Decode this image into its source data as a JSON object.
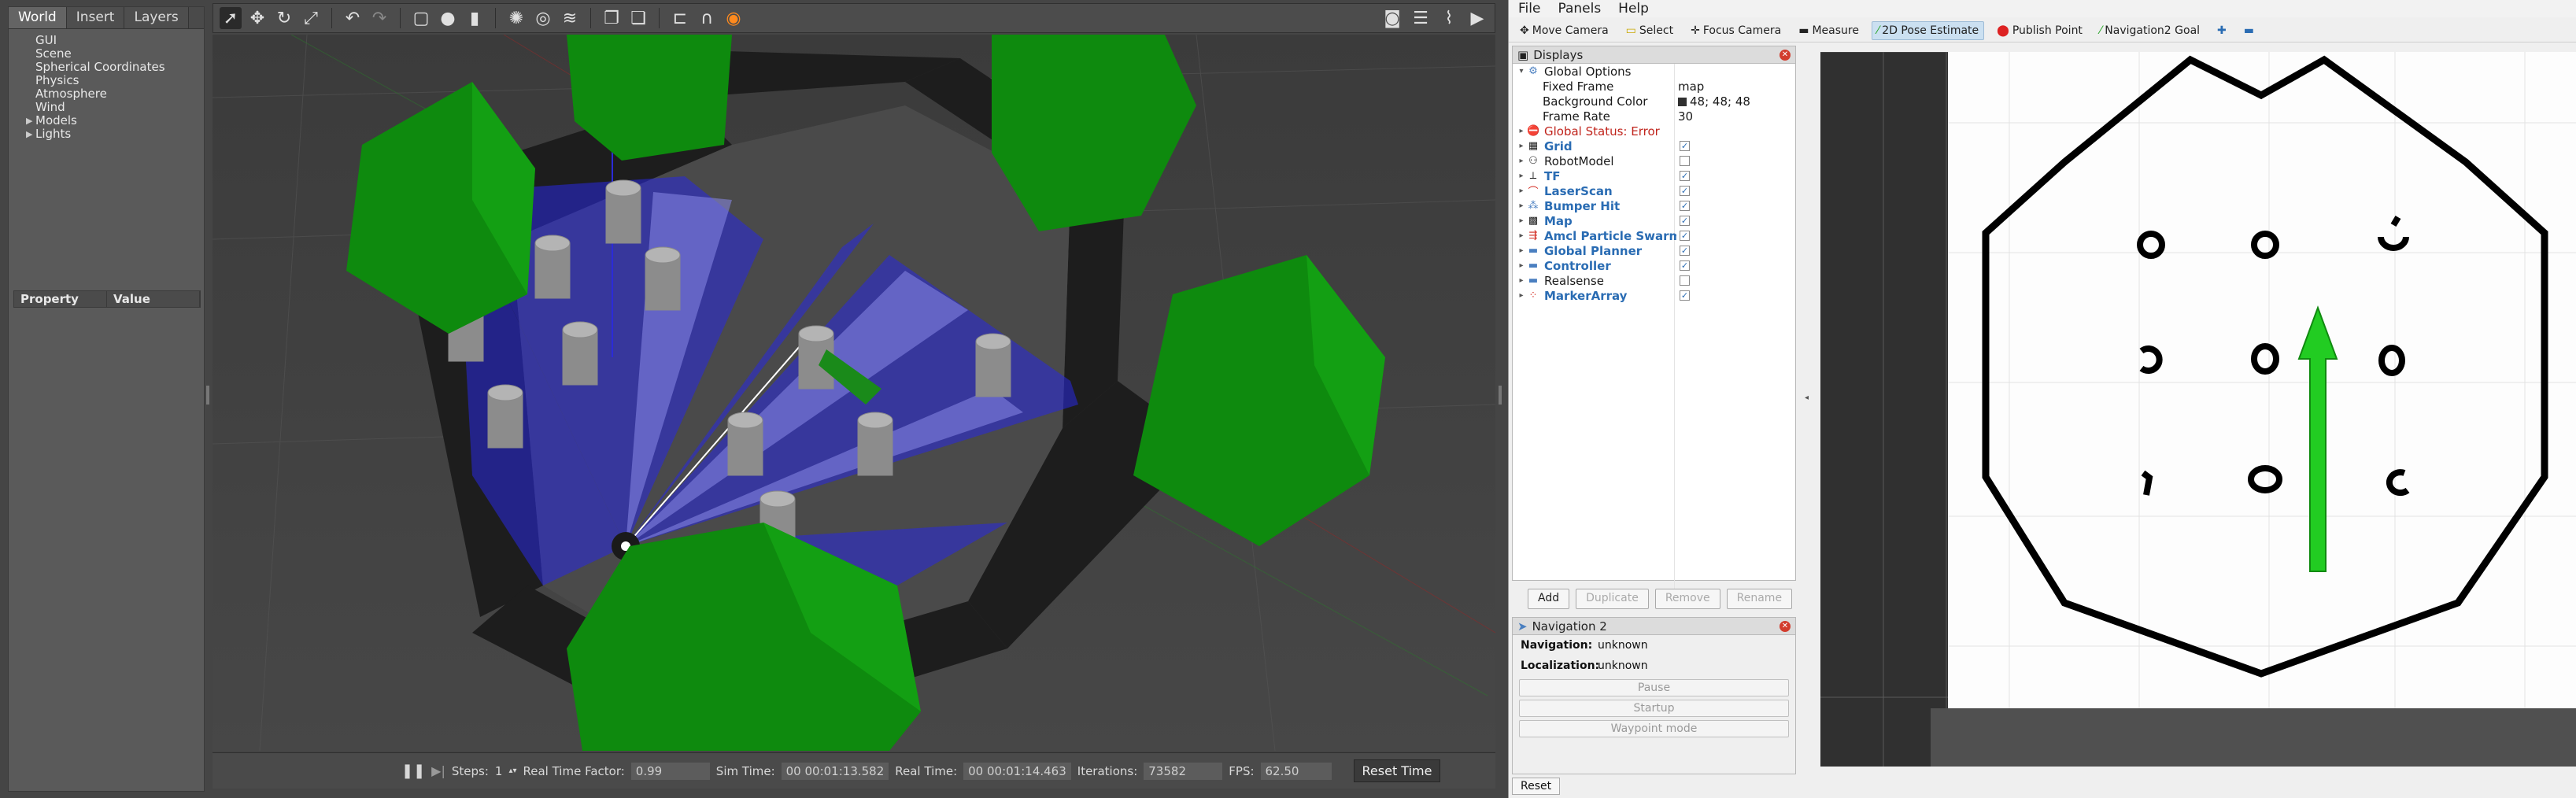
{
  "gazebo": {
    "tabs": [
      "World",
      "Insert",
      "Layers"
    ],
    "world_tree": [
      "GUI",
      "Scene",
      "Spherical Coordinates",
      "Physics",
      "Atmosphere",
      "Wind",
      "Models",
      "Lights"
    ],
    "prop_headers": [
      "Property",
      "Value"
    ],
    "bottom": {
      "steps_label": "Steps:",
      "steps_value": "1",
      "rtf_label": "Real Time Factor:",
      "rtf_value": "0.99",
      "sim_time_label": "Sim Time:",
      "sim_time_value": "00 00:01:13.582",
      "real_time_label": "Real Time:",
      "real_time_value": "00 00:01:14.463",
      "iterations_label": "Iterations:",
      "iterations_value": "73582",
      "fps_label": "FPS:",
      "fps_value": "62.50",
      "reset_time": "Reset Time"
    }
  },
  "rviz": {
    "menu": [
      "File",
      "Panels",
      "Help"
    ],
    "tools": [
      {
        "label": "Move Camera",
        "icon": "move-camera-icon"
      },
      {
        "label": "Select",
        "icon": "select-icon"
      },
      {
        "label": "Focus Camera",
        "icon": "focus-camera-icon"
      },
      {
        "label": "Measure",
        "icon": "measure-icon"
      },
      {
        "label": "2D Pose Estimate",
        "icon": "pose-estimate-icon"
      },
      {
        "label": "Publish Point",
        "icon": "publish-point-icon"
      },
      {
        "label": "Navigation2 Goal",
        "icon": "nav-goal-icon"
      }
    ],
    "displays_title": "Displays",
    "global_options": "Global Options",
    "fixed_frame_label": "Fixed Frame",
    "fixed_frame_value": "map",
    "bg_color_label": "Background Color",
    "bg_color_value": "48; 48; 48",
    "frame_rate_label": "Frame Rate",
    "frame_rate_value": "30",
    "global_status": "Global Status: Error",
    "displays": [
      "Grid",
      "RobotModel",
      "TF",
      "LaserScan",
      "Bumper Hit",
      "Map",
      "Amcl Particle Swarm",
      "Global Planner",
      "Controller",
      "Realsense",
      "MarkerArray"
    ],
    "display_buttons": [
      "Add",
      "Duplicate",
      "Remove",
      "Rename"
    ],
    "nav2_title": "Navigation 2",
    "navigation_label": "Navigation:",
    "navigation_value": "unknown",
    "localization_label": "Localization:",
    "localization_value": "unknown",
    "pause": "Pause",
    "startup": "Startup",
    "waypoint": "Waypoint mode",
    "reset": "Reset"
  },
  "colors": {
    "accent_blue": "#2a6cb3",
    "error_red": "#c0241c",
    "laser": "#2828e0",
    "tree_green": "#1a9a1a",
    "arrow_green": "#22cc22"
  }
}
